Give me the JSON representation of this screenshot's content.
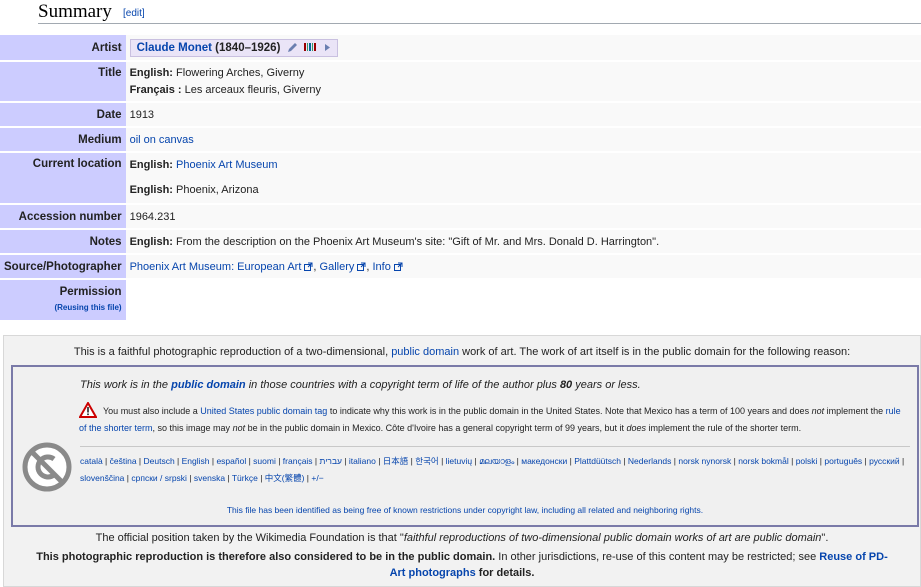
{
  "section": {
    "title": "Summary",
    "edit": "[edit]"
  },
  "rows": {
    "artist": {
      "label": "Artist",
      "name": "Claude Monet",
      "years": "(1840–1926)"
    },
    "title": {
      "label": "Title",
      "en_lang": "English:",
      "en_value": "Flowering Arches, Giverny",
      "fr_lang": "Français :",
      "fr_value": "Les arceaux fleuris, Giverny"
    },
    "date": {
      "label": "Date",
      "value": "1913"
    },
    "medium": {
      "label": "Medium",
      "value": "oil on canvas"
    },
    "location": {
      "label": "Current location",
      "en1_lang": "English:",
      "en1_value": "Phoenix Art Museum",
      "en2_lang": "English:",
      "en2_value": "Phoenix, Arizona"
    },
    "accession": {
      "label": "Accession number",
      "value": "1964.231"
    },
    "notes": {
      "label": "Notes",
      "lang": "English:",
      "value": "From the description on the Phoenix Art Museum's site: \"Gift of Mr. and Mrs. Donald D. Harrington\"."
    },
    "source": {
      "label": "Source/Photographer",
      "link1": "Phoenix Art Museum: European Art",
      "link2": "Gallery",
      "link3": "Info"
    },
    "permission": {
      "label": "Permission",
      "sub": "(Reusing this file)"
    }
  },
  "license": {
    "intro_a": "This is a faithful photographic reproduction of a two-dimensional, ",
    "intro_link": "public domain",
    "intro_b": " work of art. The work of art itself is in the public domain for the following reason:",
    "pd_a": "This work is in the ",
    "pd_link": "public domain",
    "pd_b": " in those countries with a copyright term of life of the author plus ",
    "pd_years": "80",
    "pd_c": " years or less.",
    "warn_a": "You must also include a ",
    "warn_link1": "United States public domain tag",
    "warn_b": " to indicate why this work is in the public domain in the United States. Note that Mexico has a term of 100 years and does ",
    "warn_not": "not",
    "warn_c": " implement the ",
    "warn_link2": "rule of the shorter term",
    "warn_d": ", so this image may ",
    "warn_not2": "not",
    "warn_e": " be in the public domain in Mexico. Côte d'Ivoire has a general copyright term of 99 years, but it ",
    "warn_does": "does",
    "warn_f": " implement the rule of the shorter term.",
    "languages": [
      "català",
      "čeština",
      "Deutsch",
      "English",
      "español",
      "suomi",
      "français",
      "עברית",
      "italiano",
      "日本語",
      "한국어",
      "lietuvių",
      "മലയാളം",
      "македонски",
      "Plattdüütsch",
      "Nederlands",
      "norsk nynorsk",
      "norsk bokmål",
      "polski",
      "português",
      "русский",
      "slovenščina",
      "српски / srpski",
      "svenska",
      "Türkçe",
      "中文(繁體)",
      "+/−"
    ],
    "identified": "This file has been identified as being free of known restrictions under copyright law, including all related and neighboring rights.",
    "official_a": "The official position taken by the Wikimedia Foundation is that \"",
    "official_quote": "faithful reproductions of two-dimensional public domain works of art are public domain",
    "official_b": "\".",
    "final_bold": "This photographic reproduction is therefore also considered to be in the public domain.",
    "final_plain": " In other jurisdictions, re-use of this content may be restricted; see ",
    "final_link": "Reuse of PD-Art photographs",
    "final_end": " for details."
  },
  "colors": {
    "label_bg": "#ccccff",
    "link": "#0645ad",
    "warn_red": "#cc0000"
  }
}
